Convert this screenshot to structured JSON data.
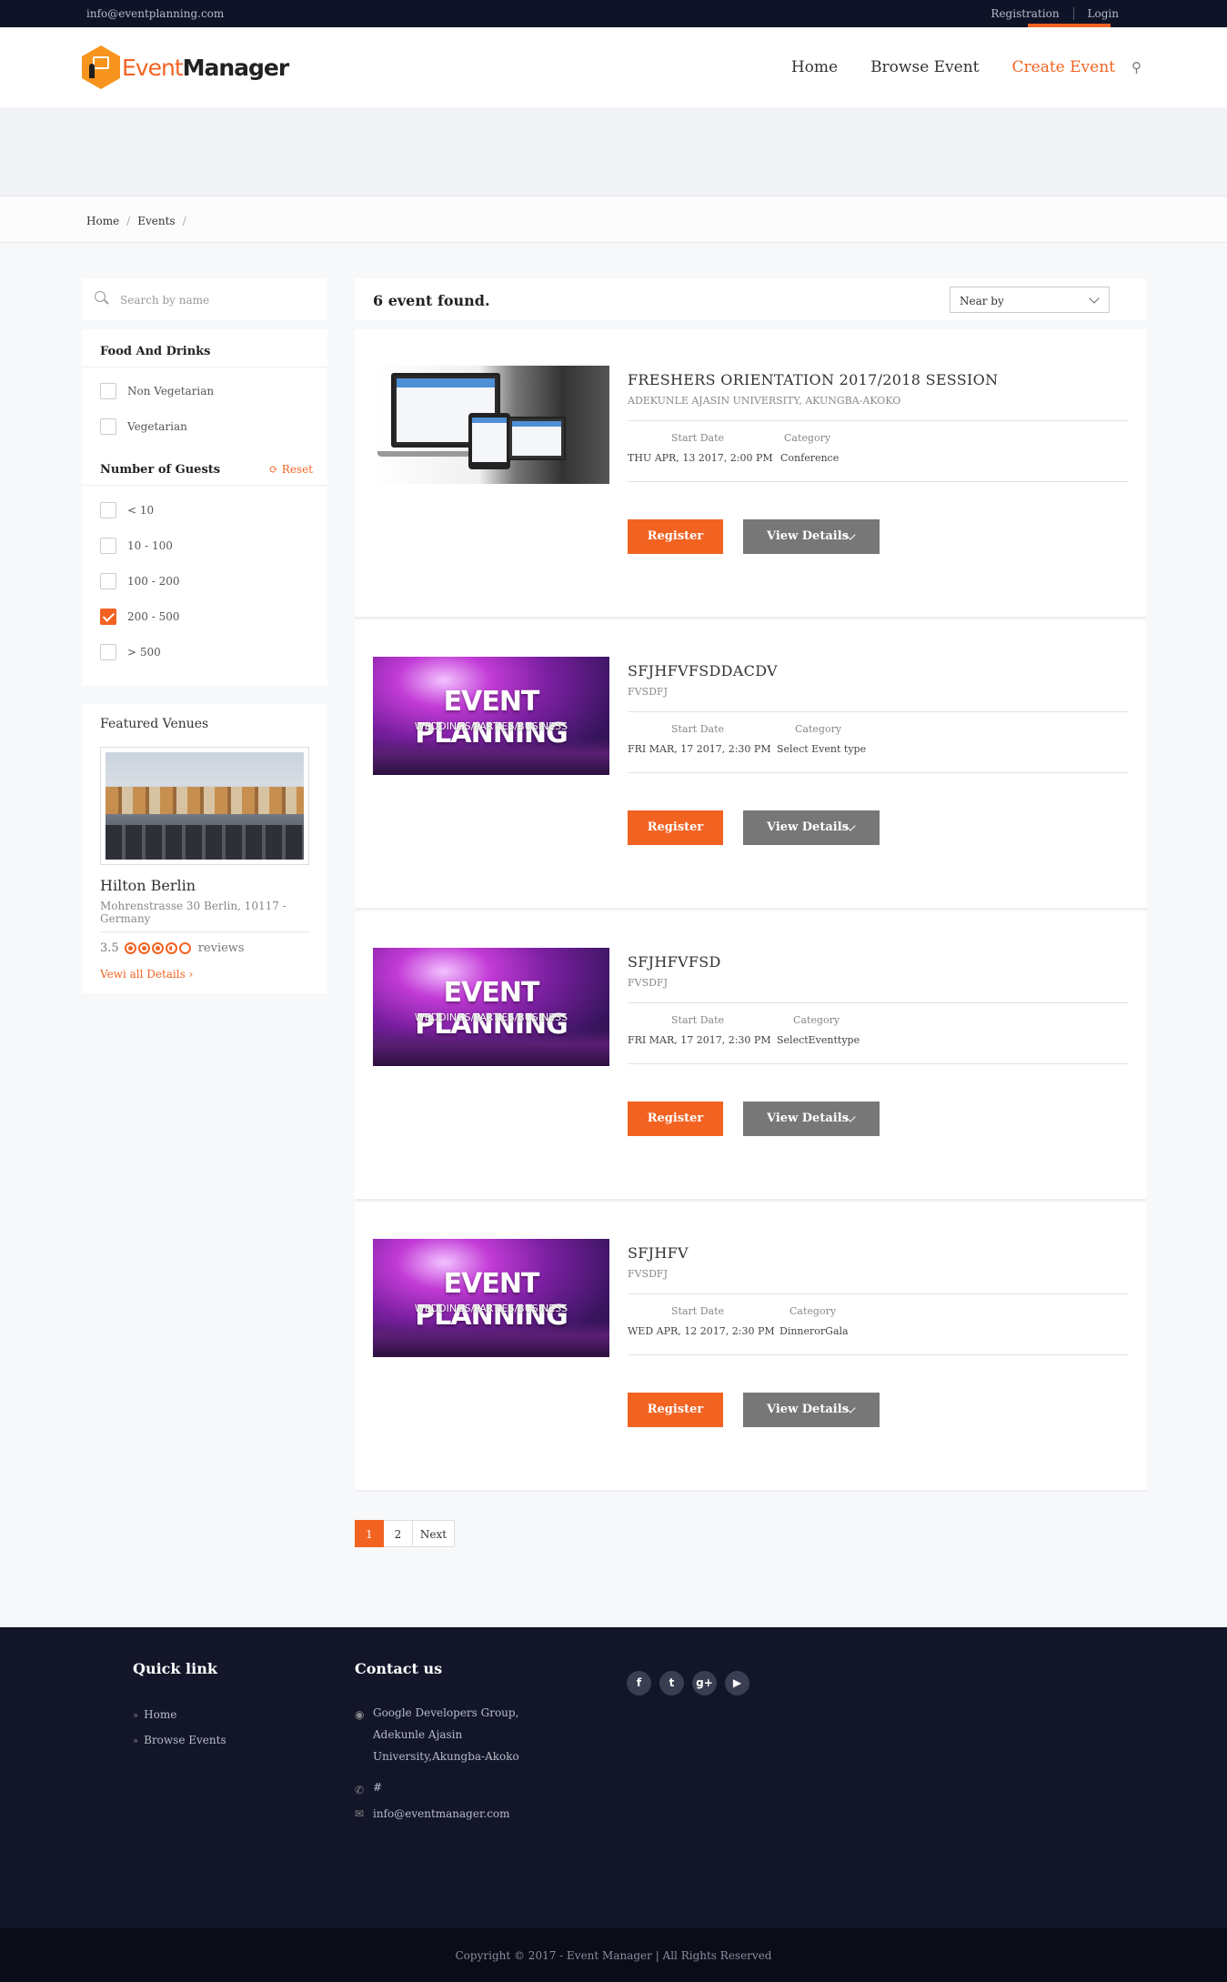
{
  "topbar": {
    "email": "info@eventplanning.com",
    "registration": "Registration",
    "login": "Login"
  },
  "logo": {
    "part1": "Event",
    "part2": "Manager"
  },
  "nav": {
    "home": "Home",
    "browse": "Browse Event",
    "create": "Create Event"
  },
  "breadcrumb": {
    "home": "Home",
    "events": "Events"
  },
  "search": {
    "placeholder": "Search by name"
  },
  "filters": {
    "food_title": "Food And Drinks",
    "food_options": [
      "Non Vegetarian",
      "Vegetarian"
    ],
    "guests_title": "Number of Guests",
    "reset": "Reset",
    "guest_options": [
      "< 10",
      "10 - 100",
      "100 - 200",
      "200 - 500",
      "> 500"
    ],
    "guest_checked": "200 - 500"
  },
  "venues": {
    "title": "Featured Venues",
    "name": "Hilton Berlin",
    "address": "Mohrenstrasse 30 Berlin, 10117 - Germany",
    "rating": "3.5",
    "reviews": "reviews",
    "view_all": "Vewi all Details"
  },
  "results": {
    "count_text": "6 event found.",
    "sort": "Near by"
  },
  "events": [
    {
      "title": "FRESHERS ORIENTATION 2017/2018 SESSION",
      "subtitle": "ADEKUNLE AJASIN UNIVERSITY, AKUNGBA-AKOKO",
      "start_label": "Start Date",
      "category_label": "Category",
      "start": "THU APR, 13 2017, 2:00 PM",
      "category": "Conference",
      "register": "Register",
      "details": "View Details",
      "image": "devices"
    },
    {
      "title": "SFJHFVFSDDACDV",
      "subtitle": "FVSDFJ",
      "start_label": "Start Date",
      "category_label": "Category",
      "start": "FRI MAR, 17 2017, 2:30 PM",
      "category": "Select Event type",
      "register": "Register",
      "details": "View Details",
      "image": "event-planning",
      "img_big": "EVENT PLANNING",
      "img_small": "WEDDINGS/PARTIES/BUSINESS"
    },
    {
      "title": "SFJHFVFSD",
      "subtitle": "FVSDFJ",
      "start_label": "Start Date",
      "category_label": "Category",
      "start": "FRI MAR, 17 2017, 2:30 PM",
      "category": "SelectEventtype",
      "register": "Register",
      "details": "View Details",
      "image": "event-planning",
      "img_big": "EVENT PLANNING",
      "img_small": "WEDDINGS/PARTIES/BUSINESS"
    },
    {
      "title": "SFJHFV",
      "subtitle": "FVSDFJ",
      "start_label": "Start Date",
      "category_label": "Category",
      "start": "WED APR, 12 2017, 2:30 PM",
      "category": "DinnerorGala",
      "register": "Register",
      "details": "View Details",
      "image": "event-planning",
      "img_big": "EVENT PLANNING",
      "img_small": "WEDDINGS/PARTIES/BUSINESS"
    }
  ],
  "pagination": {
    "pages": [
      "1",
      "2"
    ],
    "current": "1",
    "next": "Next"
  },
  "footer": {
    "quick_title": "Quick link",
    "quick_links": [
      "Home",
      "Browse Events"
    ],
    "contact_title": "Contact us",
    "address_lines": [
      "Google Developers Group,",
      "Adekunle Ajasin",
      "University,Akungba-Akoko"
    ],
    "phone": "#",
    "email": "info@eventmanager.com",
    "social": [
      "facebook-icon",
      "twitter-icon",
      "google-plus-icon",
      "youtube-icon"
    ]
  },
  "copyright": "Copyright © 2017 - Event Manager | All Rights Reserved",
  "colors": {
    "accent": "#f26322",
    "footer_bg": "#131629",
    "topbar_bg": "#0f1327"
  }
}
